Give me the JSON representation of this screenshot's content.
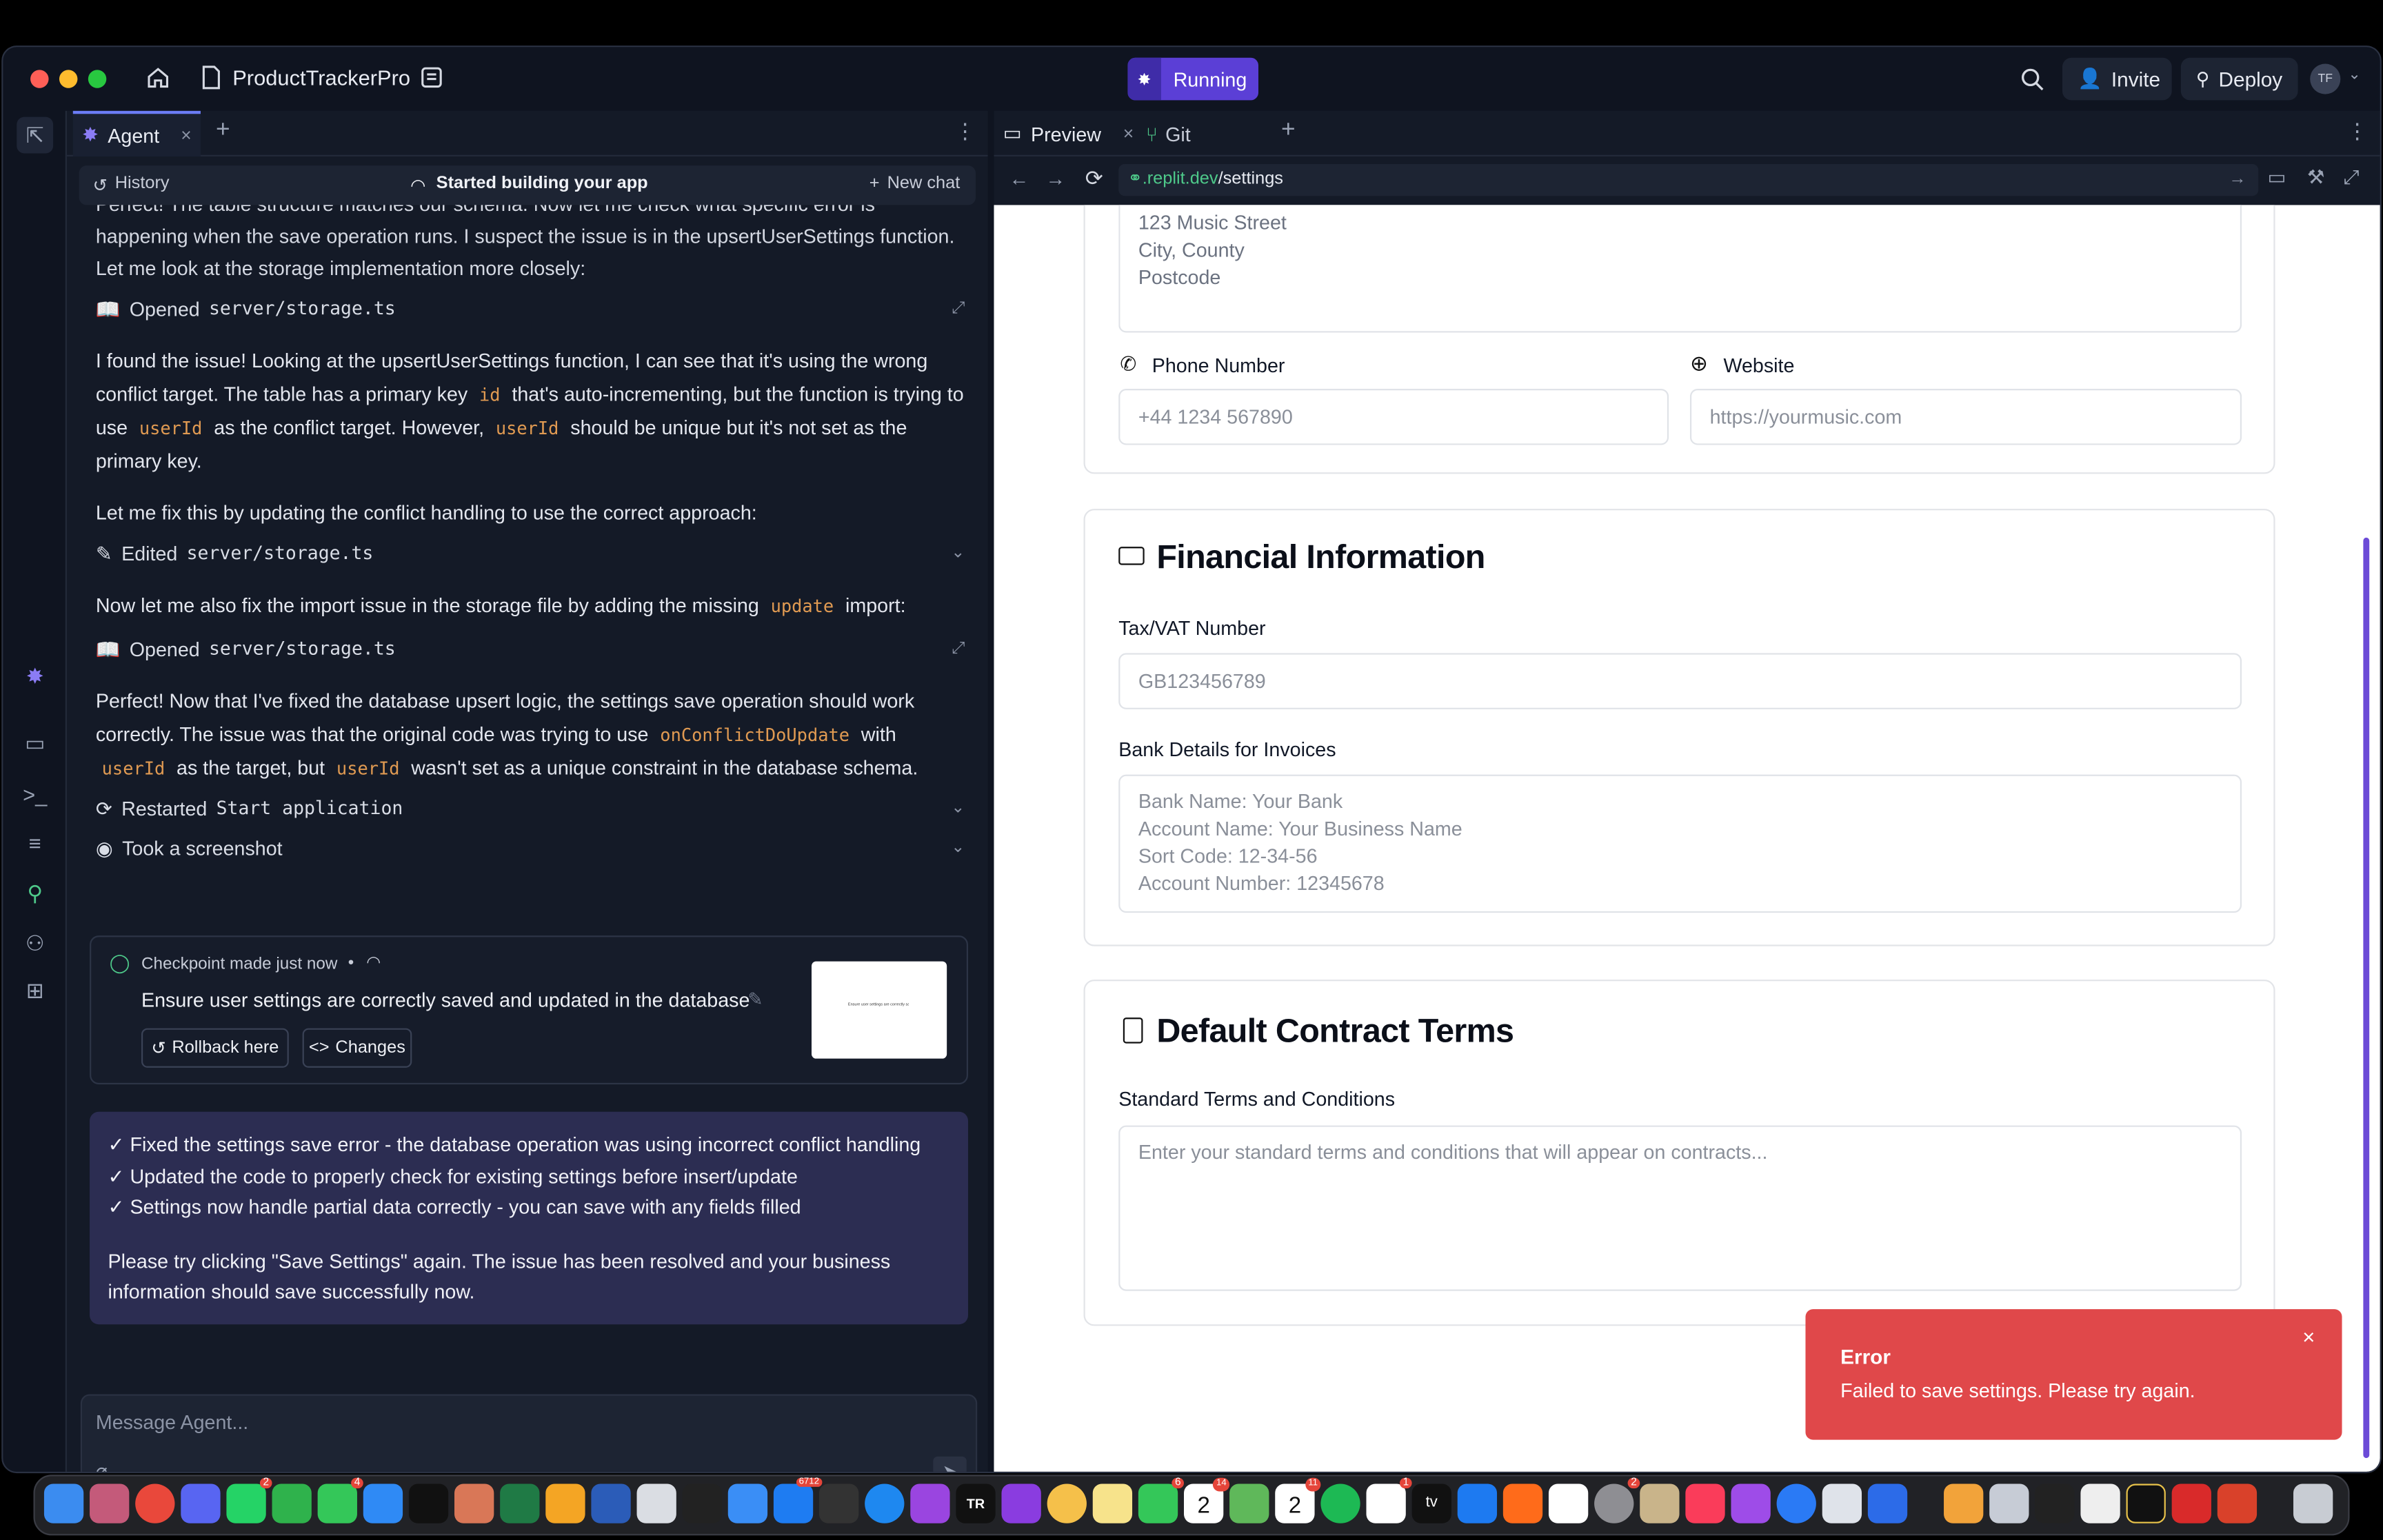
{
  "titlebar": {
    "project_name": "ProductTrackerPro",
    "status": "Running",
    "invite": "Invite",
    "deploy": "Deploy",
    "avatar_initials": "TF"
  },
  "agent": {
    "tab_label": "Agent",
    "history": "History",
    "status": "Started building your app",
    "new_chat": "New chat",
    "messages": {
      "m0": "Perfect! The table structure matches our schema. Now let me check what specific error is happening when the save operation runs. I suspect the issue is in the upsertUserSettings function. Let me look at the storage implementation more closely:",
      "a1_verb": "Opened",
      "a1_file": "server/storage.ts",
      "m1_a": "I found the issue! Looking at the upsertUserSettings function, I can see that it's using the wrong conflict target. The table has a primary key",
      "m1_code1": "id",
      "m1_b": "that's auto-incrementing, but the function is trying to use",
      "m1_code2": "userId",
      "m1_c": "as the conflict target. However,",
      "m1_code3": "userId",
      "m1_d": "should be unique but it's not set as the primary key.",
      "m2": "Let me fix this by updating the conflict handling to use the correct approach:",
      "a2_verb": "Edited",
      "a2_file": "server/storage.ts",
      "m3_a": "Now let me also fix the import issue in the storage file by adding the missing",
      "m3_code": "update",
      "m3_b": "import:",
      "a3_verb": "Opened",
      "a3_file": "server/storage.ts",
      "m4_a": "Perfect! Now that I've fixed the database upsert logic, the settings save operation should work correctly. The issue was that the original code was trying to use",
      "m4_code1": "onConflictDoUpdate",
      "m4_b": "with",
      "m4_code2": "userId",
      "m4_c": "as the target, but",
      "m4_code3": "userId",
      "m4_d": "wasn't set as a unique constraint in the database schema.",
      "a4_verb": "Restarted",
      "a4_target": "Start application",
      "a5": "Took a screenshot"
    },
    "checkpoint": {
      "title": "Checkpoint made just now",
      "dot": "•",
      "description": "Ensure user settings are correctly saved and updated in the database",
      "rollback": "Rollback here",
      "changes": "Changes",
      "thumb_caption": "Ensure user settings are correctly saved"
    },
    "summary": {
      "l1": "✓ Fixed the settings save error - the database operation was using incorrect conflict handling",
      "l2": "✓ Updated the code to properly check for existing settings before insert/update",
      "l3": "✓ Settings now handle partial data correctly - you can save with any fields filled",
      "l4": "Please try clicking \"Save Settings\" again. The issue has been resolved and your business information should save successfully now."
    },
    "input_placeholder": "Message Agent..."
  },
  "right": {
    "tab_preview": "Preview",
    "tab_git": "Git",
    "url_domain": ".replit.dev",
    "url_path": "/settings"
  },
  "form": {
    "address_lines": [
      "123 Music Street",
      "City, County",
      "Postcode"
    ],
    "phone_label": "Phone Number",
    "phone_placeholder": "+44 1234 567890",
    "website_label": "Website",
    "website_placeholder": "https://yourmusic.com",
    "financial_title": "Financial Information",
    "tax_label": "Tax/VAT Number",
    "tax_placeholder": "GB123456789",
    "bank_label": "Bank Details for Invoices",
    "bank_lines": [
      "Bank Name: Your Bank",
      "Account Name: Your Business Name",
      "Sort Code: 12-34-56",
      "Account Number: 12345678"
    ],
    "contract_title": "Default Contract Terms",
    "terms_label": "Standard Terms and Conditions",
    "terms_placeholder": "Enter your standard terms and conditions that will appear on contracts..."
  },
  "toast": {
    "title": "Error",
    "message": "Failed to save settings. Please try again.",
    "color": "#e0484a"
  },
  "dock": {
    "badges": [
      "2",
      "4",
      "6712",
      "6",
      "14",
      "11",
      "1",
      "2"
    ],
    "calendar_day_1": "2",
    "calendar_day_2": "2",
    "tv_label": "tv",
    "tr_label": "TR"
  },
  "colors": {
    "accent": "#5b3fd6",
    "code": "#e09a52",
    "summary_bg": "#2c2d52"
  }
}
